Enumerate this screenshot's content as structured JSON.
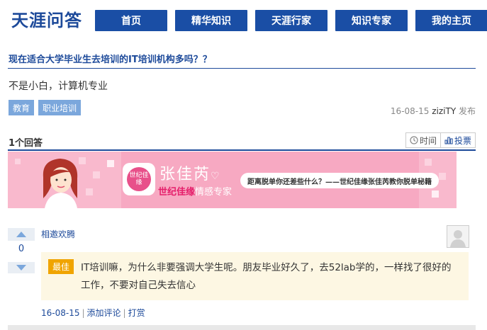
{
  "site": {
    "logo": "天涯问答"
  },
  "nav": {
    "items": [
      "首页",
      "精华知识",
      "天涯行家",
      "知识专家",
      "我的主页"
    ]
  },
  "question": {
    "title": "现在适合大学毕业生去培训的IT培训机构多吗？？",
    "body": "不是小白，计算机专业",
    "tags": [
      "教育",
      "职业培训"
    ],
    "date": "16-08-15",
    "author": "ziziTY",
    "action": "发布"
  },
  "answers_header": {
    "count_label": "1个回答",
    "sort_time": "时间",
    "sort_votes": "投票"
  },
  "ad": {
    "name": "张佳芮",
    "brand": "世纪佳缘",
    "role": "情感专家",
    "slogan": "距离脱单你还差些什么？——世纪佳缘张佳芮教你脱单秘籍",
    "logo_text": "世纪佳缘"
  },
  "answer": {
    "votes": "0",
    "author": "相邀欢腾",
    "best_label": "最佳",
    "text": "IT培训嘛，为什么非要强调大学生呢。朋友毕业好久了，去52lab学的，一样找了很好的工作，不要对自己失去信心",
    "date": "16-08-15",
    "comment_label": "添加评论",
    "tip_label": "打赏"
  },
  "colors": {
    "brand_blue": "#1a4ea5",
    "best_orange": "#f0a400",
    "ad_pink": "#f7a9c2"
  }
}
